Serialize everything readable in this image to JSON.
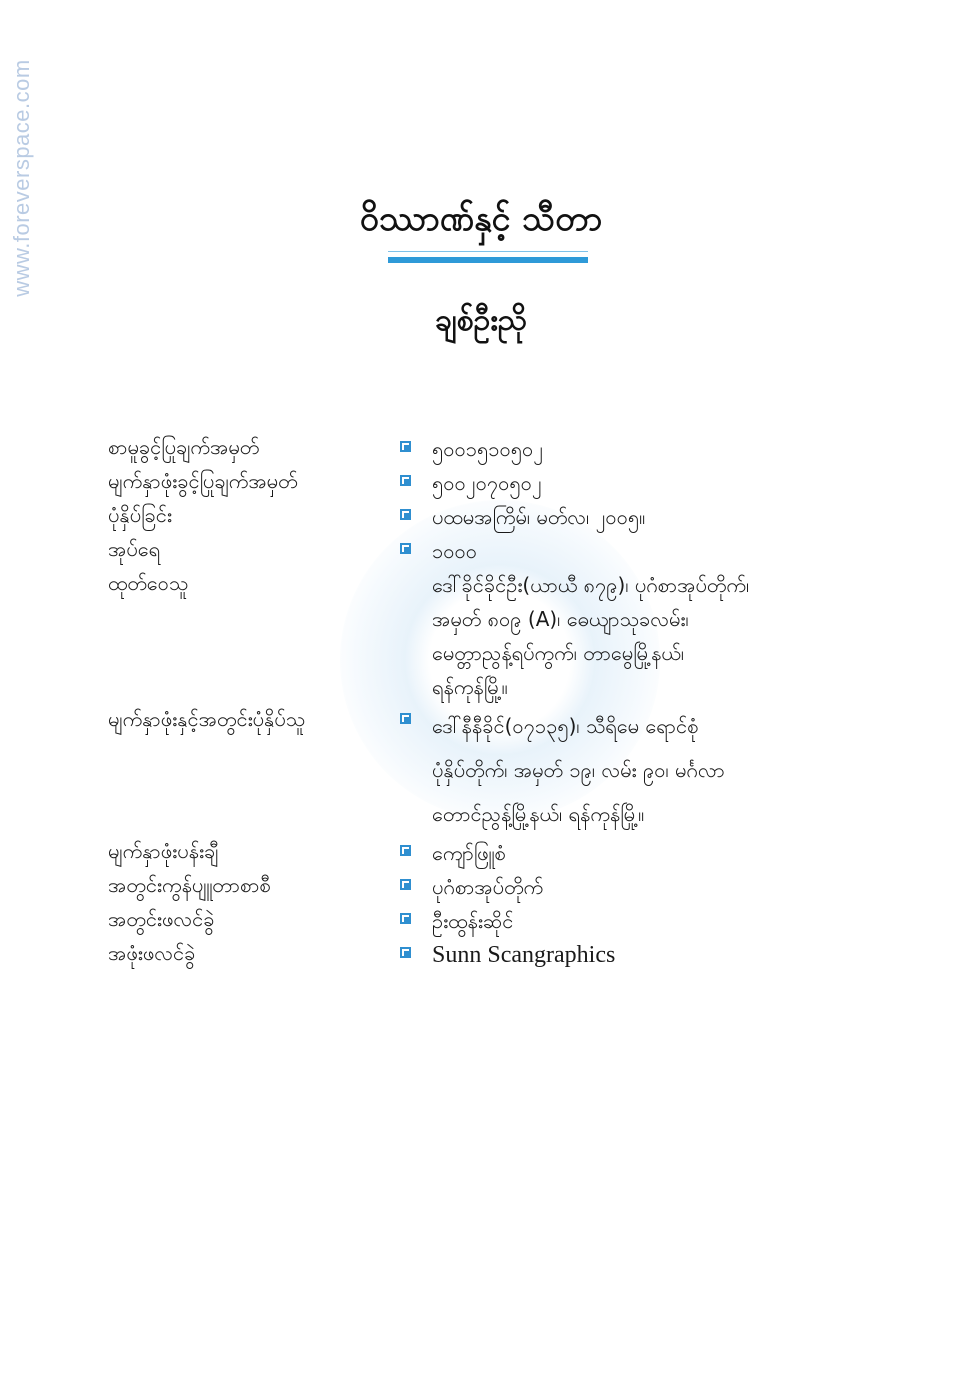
{
  "watermark_url": "www.foreverspace.com",
  "book": {
    "title": "ဝိဿာဏ်နှင့် သီတာ",
    "author": "ချစ်ဦးညို"
  },
  "colophon": [
    {
      "label": "စာမူခွင့်ပြုချက်အမှတ်",
      "bullet": true,
      "lines": [
        "၅၀၀၁၅၁၀၅၀၂"
      ]
    },
    {
      "label": "မျက်နှာဖုံးခွင့်ပြုချက်အမှတ်",
      "bullet": true,
      "lines": [
        "၅၀၀၂၀၇၀၅၀၂"
      ]
    },
    {
      "label": "ပုံနှိပ်ခြင်း",
      "bullet": true,
      "lines": [
        "ပထမအကြိမ်၊ မတ်လ၊ ၂၀၀၅။"
      ]
    },
    {
      "label": "အုပ်ရေ",
      "bullet": true,
      "lines": [
        "၁၀၀၀"
      ]
    },
    {
      "label": "ထုတ်ဝေသူ",
      "bullet": false,
      "lines": [
        "ဒေါ်ခိုင်ခိုင်ဦး(ယာယီ ၈၇၉)၊ ပုဂံစာအုပ်တိုက်၊",
        "အမှတ် ၈၀၉ (A)၊ ဓေယျာသုခလမ်း၊",
        "မေတ္တာညွန့်ရပ်ကွက်၊ တာမွေမြို့နယ်၊",
        "ရန်ကုန်မြို့။"
      ]
    },
    {
      "label": "မျက်နှာဖုံးနှင့်အတွင်းပုံနှိပ်သူ",
      "bullet": true,
      "lines": [
        "ဒေါ်နီနီခိုင်(၀၇၁၃၅)၊ သီရိမေ ရောင်စုံ",
        "ပုံနှိပ်တိုက်၊ အမှတ် ၁၉၊ လမ်း ၉၀၊ မင်္ဂလာ",
        "တောင်ညွန့်မြို့နယ်၊ ရန်ကုန်မြို့။"
      ]
    },
    {
      "label": "မျက်နှာဖုံးပန်းချီ",
      "bullet": true,
      "lines": [
        "ကျော်ဖြူစံ"
      ]
    },
    {
      "label": "အတွင်းကွန်ပျူတာစာစီ",
      "bullet": true,
      "lines": [
        "ပုဂံစာအုပ်တိုက်"
      ]
    },
    {
      "label": "အတွင်းဖလင်ခွဲ",
      "bullet": true,
      "lines": [
        "ဦးထွန်းဆိုင်"
      ]
    },
    {
      "label": "အဖုံးဖလင်ခွဲ",
      "bullet": true,
      "lines": [
        "Sunn Scangraphics"
      ]
    }
  ]
}
